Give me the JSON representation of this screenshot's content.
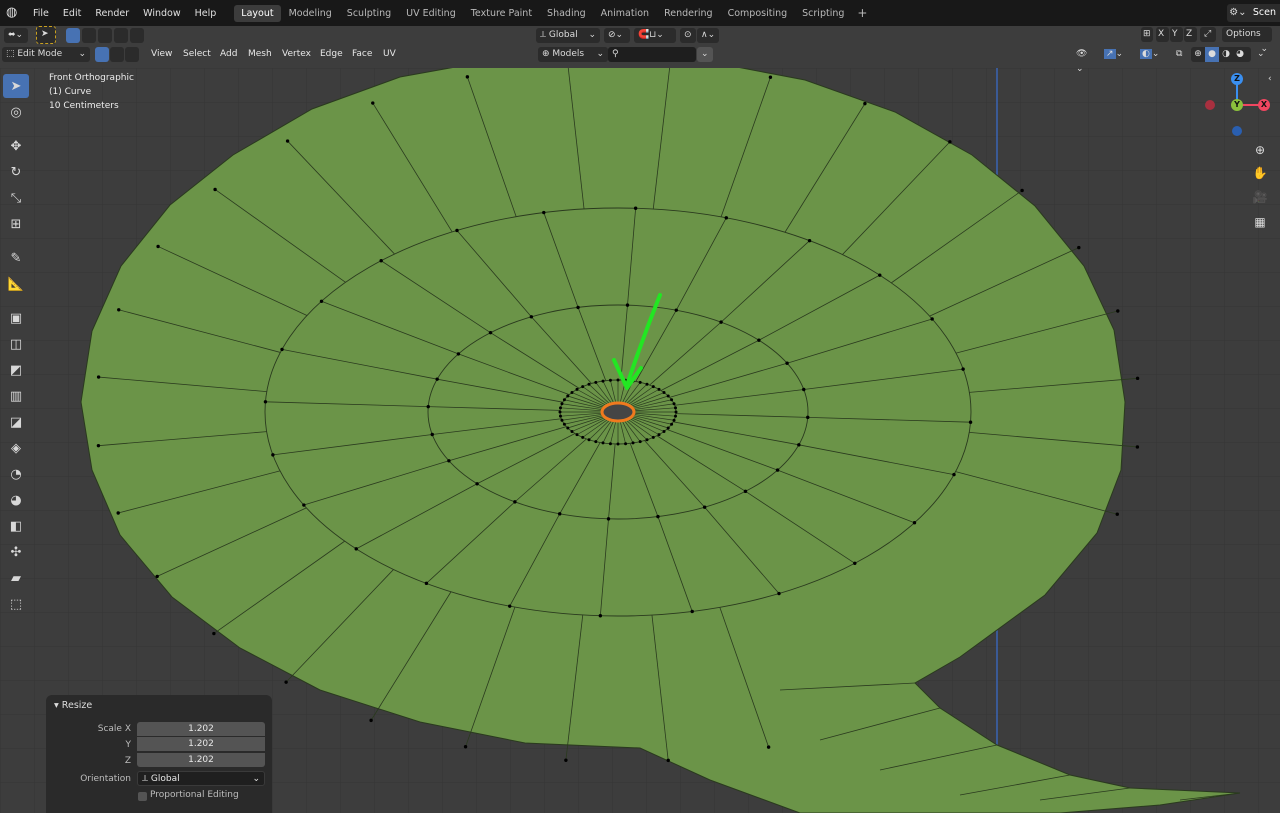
{
  "topbar": {
    "menus": [
      "File",
      "Edit",
      "Render",
      "Window",
      "Help"
    ],
    "workspaces": [
      "Layout",
      "Modeling",
      "Sculpting",
      "UV Editing",
      "Texture Paint",
      "Shading",
      "Animation",
      "Rendering",
      "Compositing",
      "Scripting"
    ],
    "active_workspace": "Layout",
    "scene_label": "Scen"
  },
  "header": {
    "mode": "Edit Mode",
    "menus": [
      "View",
      "Select",
      "Add",
      "Mesh",
      "Vertex",
      "Edge",
      "Face",
      "UV"
    ],
    "transform_orientation": "Global",
    "snap_target": "Models",
    "axes": [
      "X",
      "Y",
      "Z"
    ],
    "options_label": "Options"
  },
  "overlay": {
    "view_name": "Front Orthographic",
    "object": "(1) Curve",
    "scale": "10 Centimeters"
  },
  "gizmo": {
    "z_label": "Z",
    "y_label": "Y",
    "x_label": "X",
    "colors": {
      "x": "#f04660",
      "y": "#8bc03c",
      "z": "#3a8ff0"
    }
  },
  "mesh": {
    "fill_color": "#6b9448",
    "edge_color": "#2a3a1e",
    "selection_color": "#f07a1e",
    "annotation_color": "#22e622"
  },
  "panel": {
    "title": "Resize",
    "scale_x_label": "Scale X",
    "y_label": "Y",
    "z_label": "Z",
    "scale_x": "1.202",
    "scale_y": "1.202",
    "scale_z": "1.202",
    "orientation_label": "Orientation",
    "orientation_value": "Global",
    "proportional_label": "Proportional Editing",
    "proportional_checked": false
  }
}
